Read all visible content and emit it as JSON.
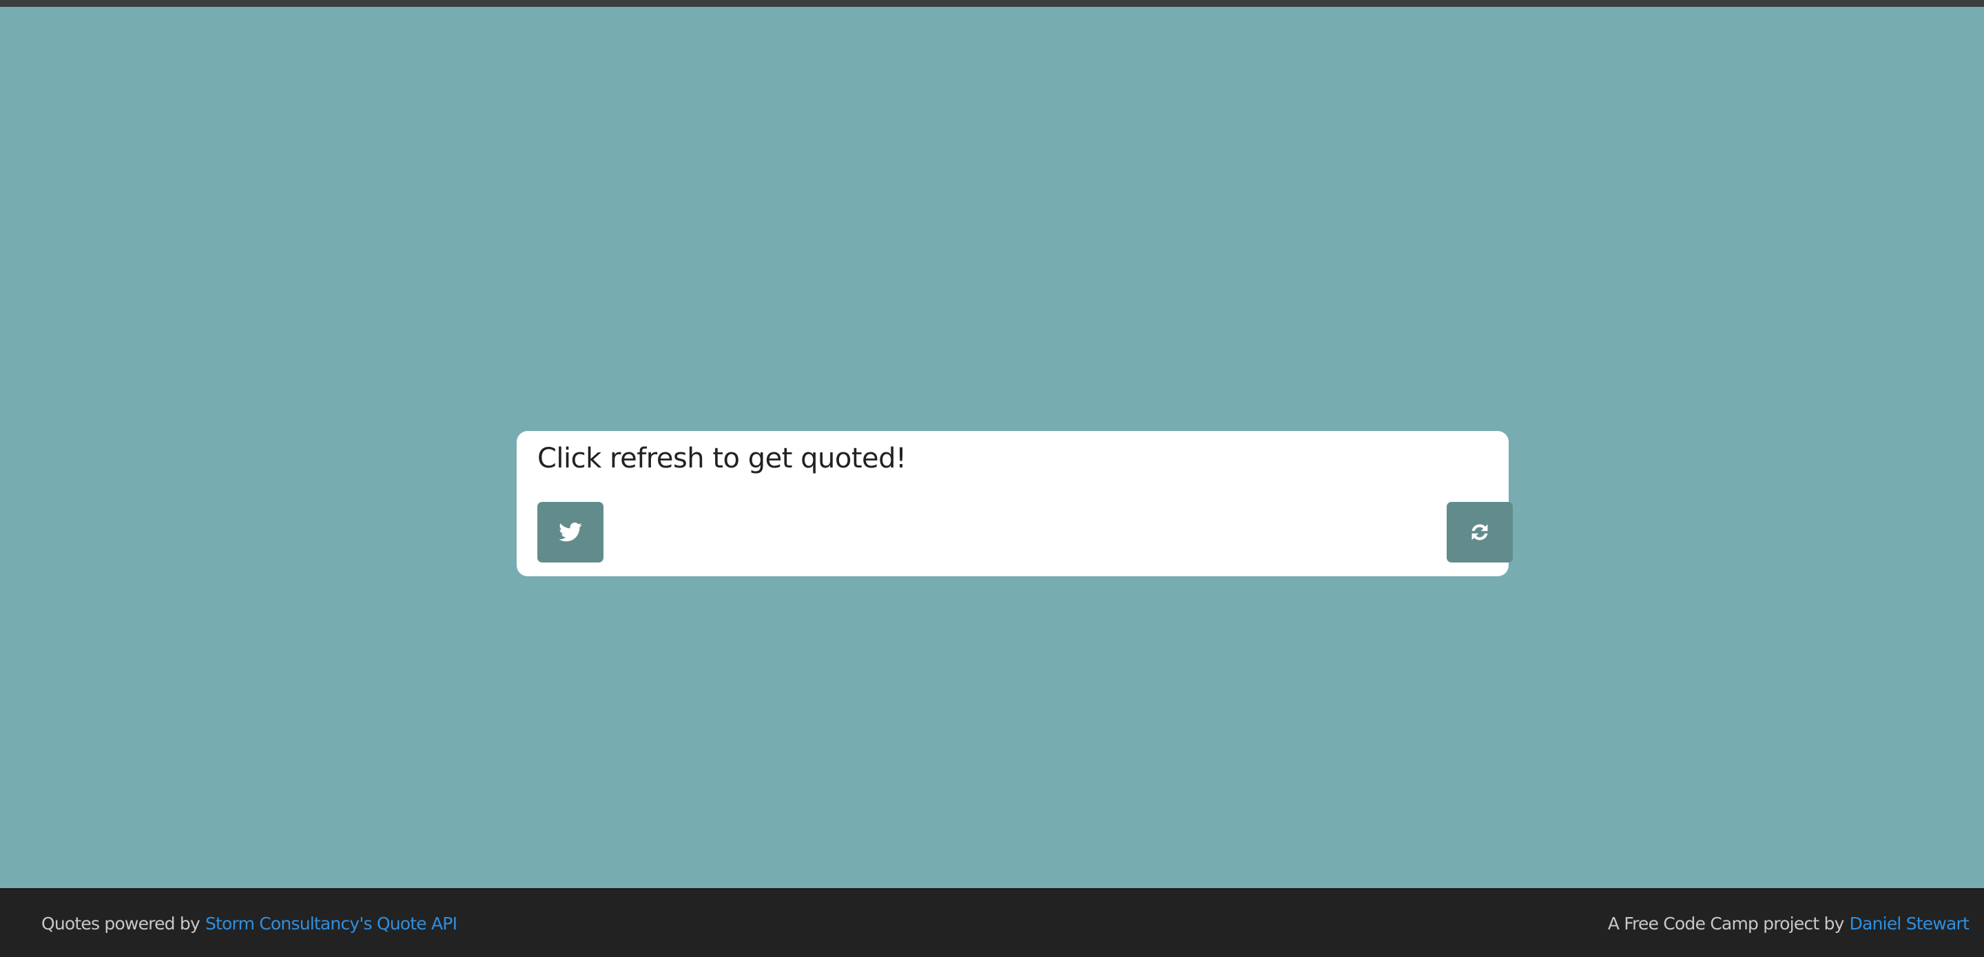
{
  "quote": {
    "text": "Click refresh to get quoted!"
  },
  "buttons": {
    "tweet_icon": "twitter-icon",
    "refresh_icon": "refresh-icon"
  },
  "footer": {
    "left_prefix": "Quotes powered by",
    "left_link": "Storm Consultancy's Quote API",
    "right_prefix": "A Free Code Camp project by",
    "right_link": "Daniel Stewart"
  },
  "colors": {
    "background": "#77adb1",
    "card": "#ffffff",
    "button": "#628c8b",
    "footer": "#222222",
    "link": "#2e8fe0"
  }
}
